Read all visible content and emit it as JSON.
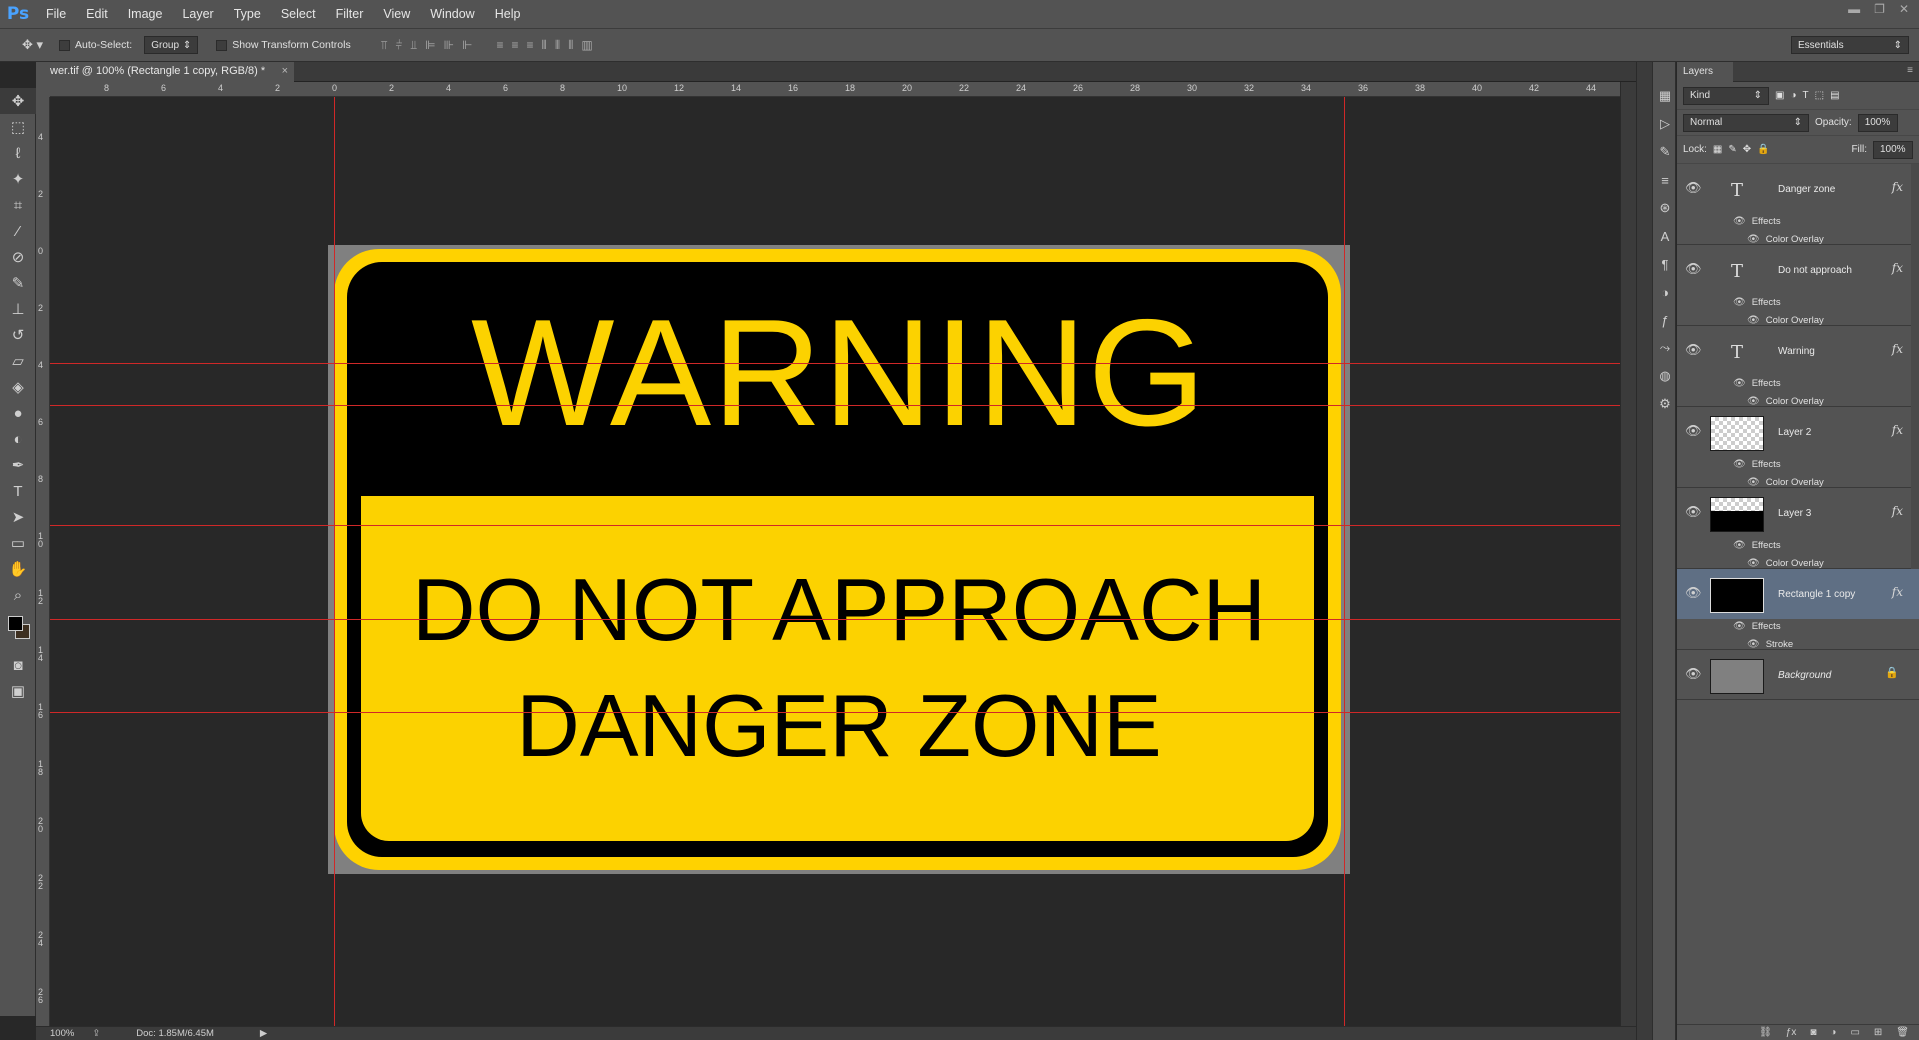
{
  "app": {
    "logo": "Ps"
  },
  "menu": [
    "File",
    "Edit",
    "Image",
    "Layer",
    "Type",
    "Select",
    "Filter",
    "View",
    "Window",
    "Help"
  ],
  "options": {
    "auto_select_label": "Auto-Select:",
    "auto_select_value": "Group",
    "show_transform_label": "Show Transform Controls",
    "workspace": "Essentials"
  },
  "document": {
    "tab_title": "wer.tif @ 100% (Rectangle 1 copy, RGB/8) *",
    "close": "×",
    "zoom": "100%",
    "doc_size": "Doc: 1.85M/6.45M"
  },
  "rulers": {
    "h_labels": [
      "8",
      "6",
      "4",
      "2",
      "0",
      "2",
      "4",
      "6",
      "8",
      "10",
      "12",
      "14",
      "16",
      "18",
      "20",
      "22",
      "24",
      "26",
      "28",
      "30",
      "32",
      "34",
      "36",
      "38",
      "40",
      "42",
      "44"
    ],
    "v_labels": [
      "4",
      "2",
      "0",
      "2",
      "4",
      "6",
      "8",
      "1 0",
      "1 2",
      "1 4",
      "1 6",
      "1 8",
      "2 0",
      "2 2",
      "2 4",
      "2 6"
    ]
  },
  "sign": {
    "headline": "WARNING",
    "line1": "DO NOT APPROACH",
    "line2": "DANGER ZONE",
    "colors": {
      "yellow": "#fcd200",
      "black": "#000000"
    }
  },
  "layers_panel": {
    "tab": "Layers",
    "filter_kind": "Kind",
    "blend_mode": "Normal",
    "opacity_label": "Opacity:",
    "opacity_value": "100%",
    "lock_label": "Lock:",
    "fill_label": "Fill:",
    "fill_value": "100%",
    "layers": [
      {
        "name": "Danger zone",
        "thumb": "text",
        "effects": "Effects",
        "effect": "Color Overlay",
        "fx": "fx"
      },
      {
        "name": "Do not approach",
        "thumb": "text",
        "effects": "Effects",
        "effect": "Color Overlay",
        "fx": "fx"
      },
      {
        "name": "Warning",
        "thumb": "text",
        "effects": "Effects",
        "effect": "Color Overlay",
        "fx": "fx"
      },
      {
        "name": "Layer 2",
        "thumb": "transparent",
        "effects": "Effects",
        "effect": "Color Overlay",
        "fx": "fx"
      },
      {
        "name": "Layer 3",
        "thumb": "transparent-black",
        "effects": "Effects",
        "effect": "Color Overlay",
        "fx": "fx"
      },
      {
        "name": "Rectangle 1 copy",
        "thumb": "black",
        "effects": "Effects",
        "effect": "Stroke",
        "fx": "fx",
        "selected": true
      },
      {
        "name": "Background",
        "thumb": "gray"
      }
    ]
  }
}
